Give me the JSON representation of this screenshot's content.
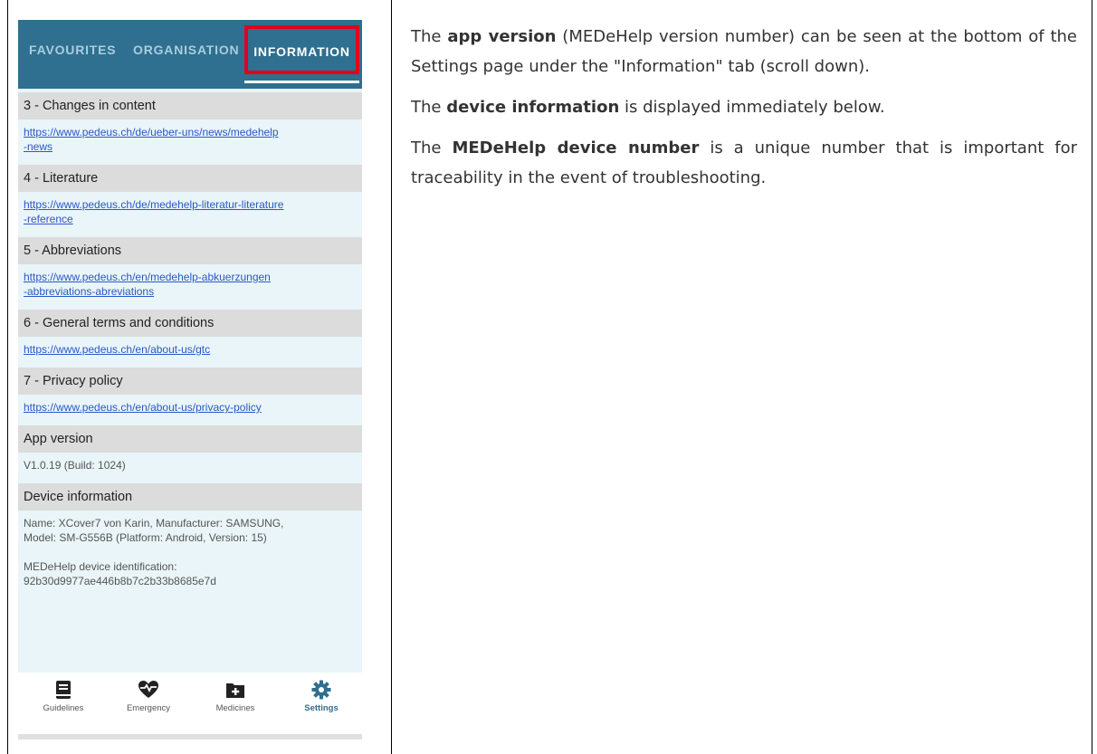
{
  "tabs": [
    "FAVOURITES",
    "ORGANISATION",
    "INFORMATION"
  ],
  "sections": [
    {
      "title": "3 - Changes in content",
      "lines": [
        "https://www.pedeus.ch/de/ueber-uns/news/medehelp",
        "-news"
      ],
      "is_link": true
    },
    {
      "title": "4 - Literature",
      "lines": [
        "https://www.pedeus.ch/de/medehelp-literatur-literature",
        "-reference"
      ],
      "is_link": true
    },
    {
      "title": "5 - Abbreviations",
      "lines": [
        "https://www.pedeus.ch/en/medehelp-abkuerzungen",
        "-abbreviations-abreviations"
      ],
      "is_link": true
    },
    {
      "title": "6 - General terms and conditions",
      "lines": [
        "https://www.pedeus.ch/en/about-us/gtc"
      ],
      "is_link": true
    },
    {
      "title": "7 - Privacy policy",
      "lines": [
        "https://www.pedeus.ch/en/about-us/privacy-policy"
      ],
      "is_link": true
    },
    {
      "title": "App version",
      "lines": [
        "V1.0.19 (Build: 1024)"
      ],
      "is_link": false
    },
    {
      "title": "Device information",
      "lines": [
        "Name: XCover7 von Karin, Manufacturer: SAMSUNG,",
        "Model: SM-G556B (Platform: Android, Version: 15)",
        "",
        "MEDeHelp device identification:",
        "92b30d9977ae446b8b7c2b33b8685e7d"
      ],
      "is_link": false
    }
  ],
  "bottom_nav": [
    {
      "label": "Guidelines",
      "icon": "book-icon"
    },
    {
      "label": "Emergency",
      "icon": "heart-pulse-icon"
    },
    {
      "label": "Medicines",
      "icon": "medicine-folder-icon"
    },
    {
      "label": "Settings",
      "icon": "gear-icon",
      "active": true
    }
  ],
  "description": {
    "p1": {
      "pre": "The ",
      "bold": "app version",
      "post": " (MEDeHelp version number) can be seen at the bottom of the Settings page under the \"Information\" tab (scroll down)."
    },
    "p2": {
      "pre": "The ",
      "bold": "device information",
      "post": " is displayed immediately below."
    },
    "p3": {
      "pre": "The ",
      "bold": "MEDeHelp device number",
      "post": " is a unique number that is important for traceability in the event of troubleshooting."
    }
  },
  "colors": {
    "header": "#2f6f8f",
    "highlight": "#e3001b",
    "link": "#2a58c8"
  }
}
